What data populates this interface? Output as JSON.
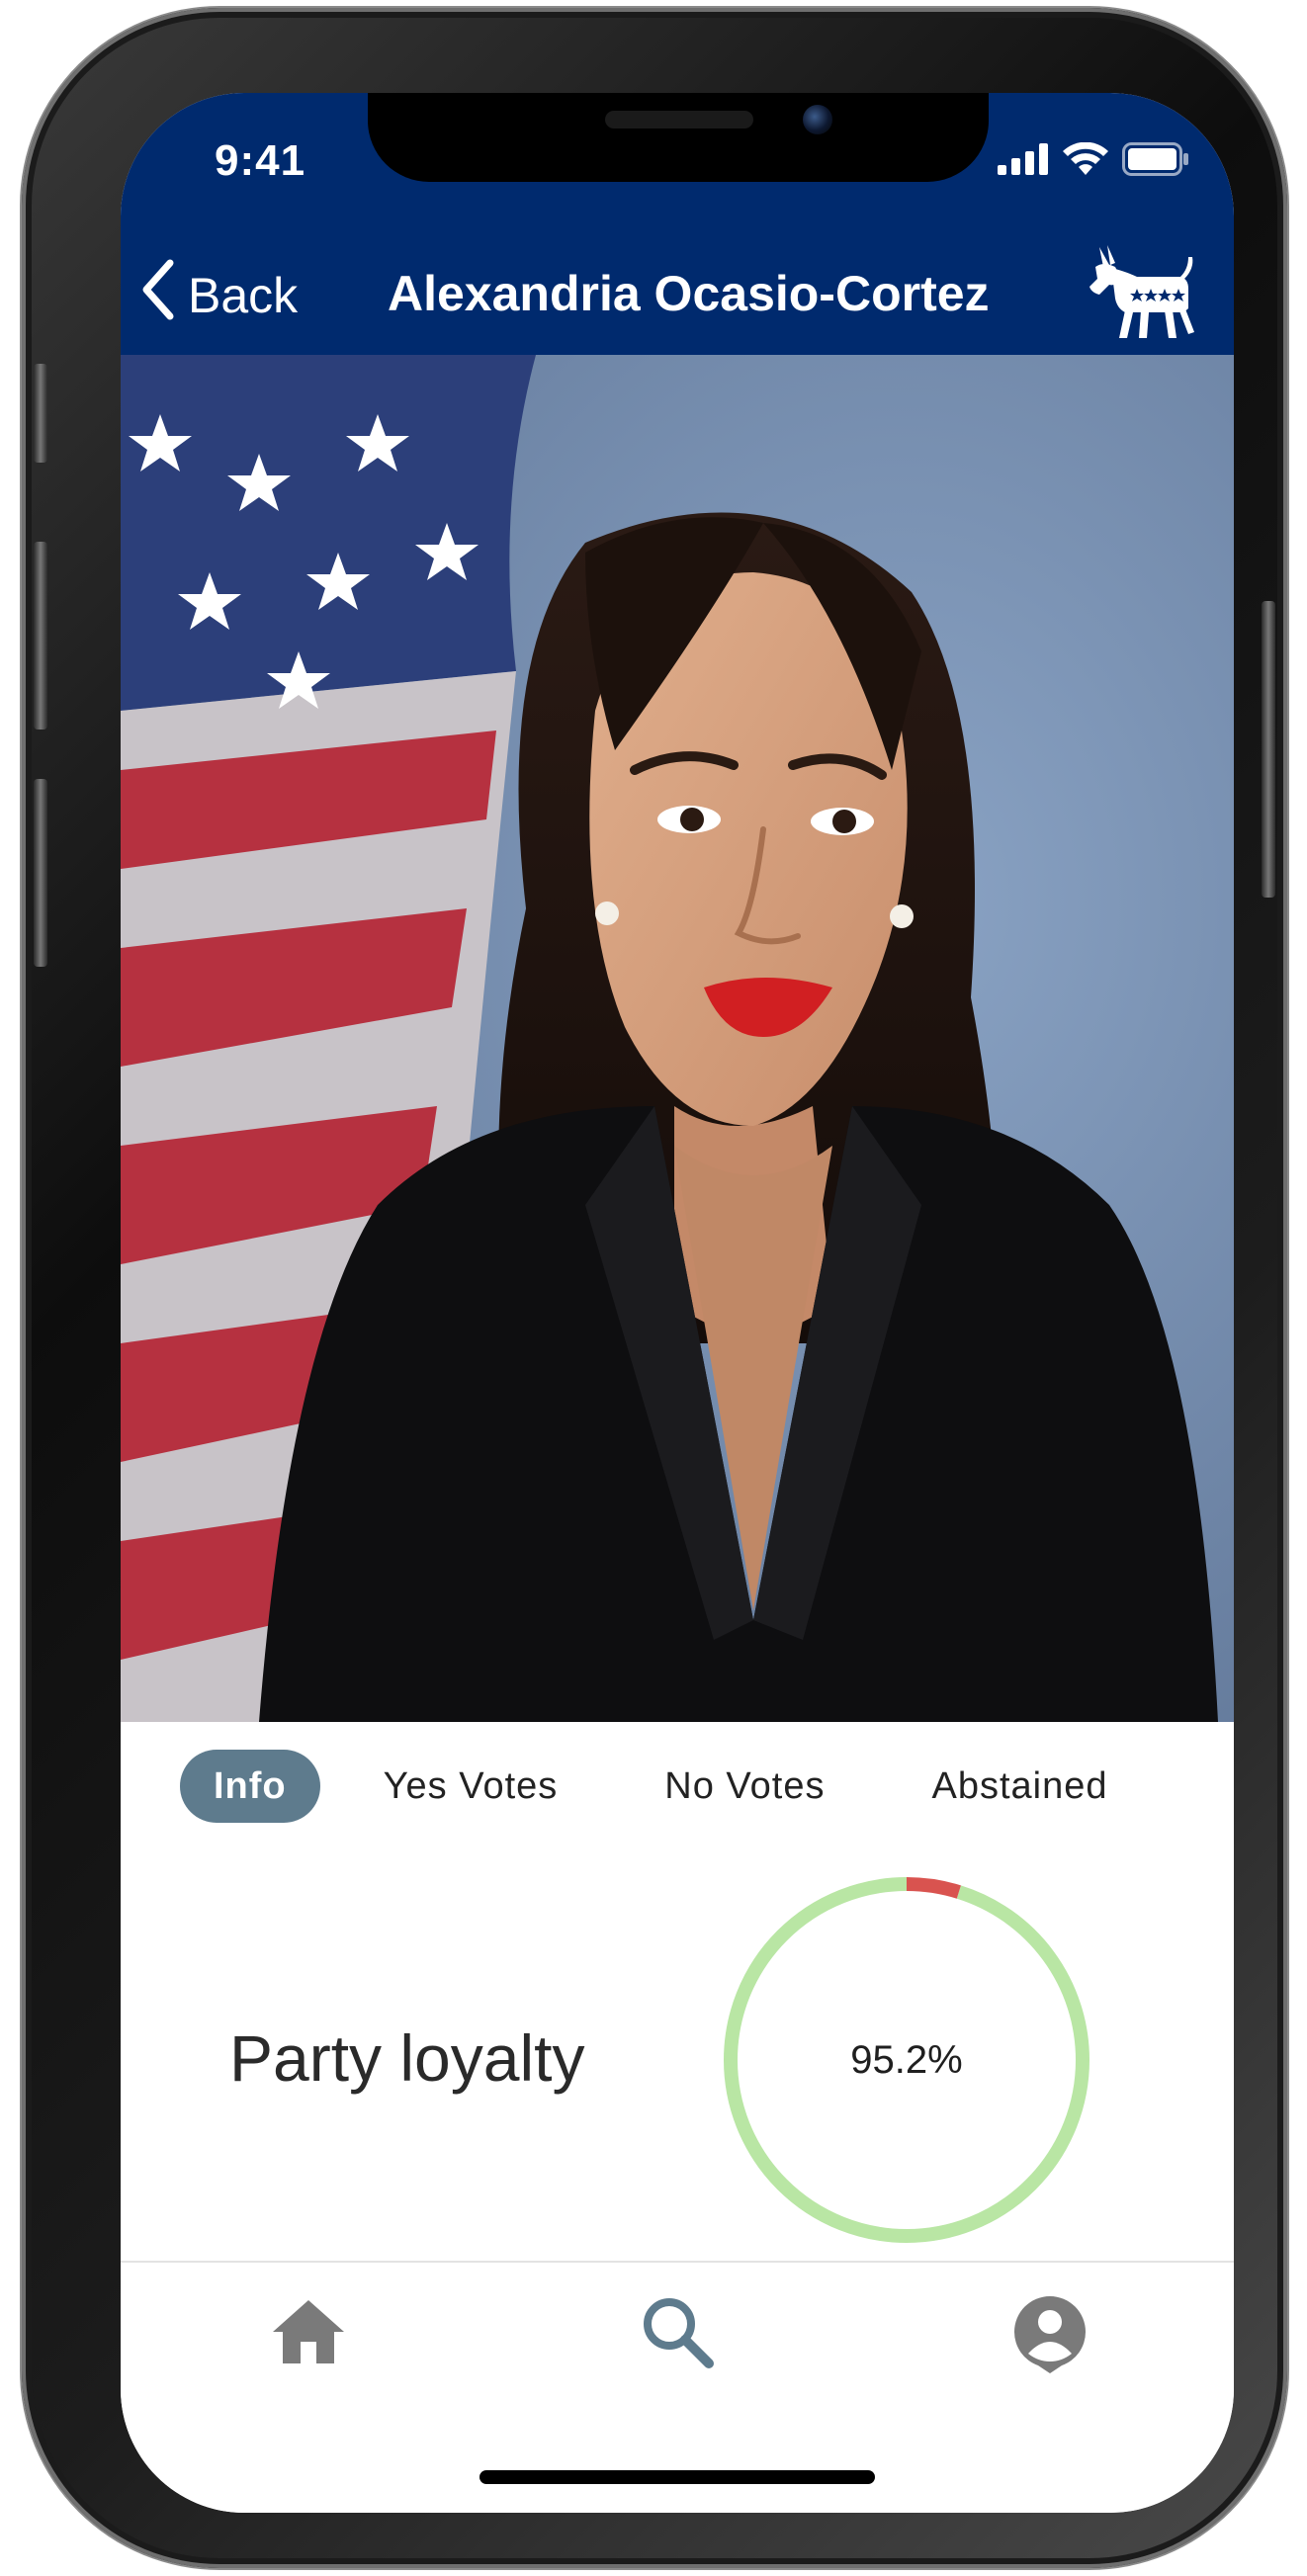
{
  "status_bar": {
    "time": "9:41",
    "icons": [
      "signal-icon",
      "wifi-icon",
      "battery-icon"
    ]
  },
  "header": {
    "back_label": "Back",
    "title": "Alexandria Ocasio-Cortez",
    "party_icon": "democrat-donkey-icon",
    "background_color": "#002a6e"
  },
  "photo": {
    "subject": "portrait"
  },
  "tabs": [
    {
      "label": "Info",
      "active": true
    },
    {
      "label": "Yes Votes",
      "active": false
    },
    {
      "label": "No Votes",
      "active": false
    },
    {
      "label": "Abstained",
      "active": false
    }
  ],
  "loyalty": {
    "label": "Party loyalty",
    "value_text": "95.2%",
    "value": 95.2,
    "loyal_color": "#b9e6a4",
    "disloyal_color": "#d9534f"
  },
  "bottom_nav": {
    "items": [
      {
        "name": "home-icon",
        "active": false
      },
      {
        "name": "search-icon",
        "active": true
      },
      {
        "name": "profile-icon",
        "active": false
      }
    ],
    "active_color": "#5e7b8d",
    "inactive_color": "#7a7a7a"
  }
}
